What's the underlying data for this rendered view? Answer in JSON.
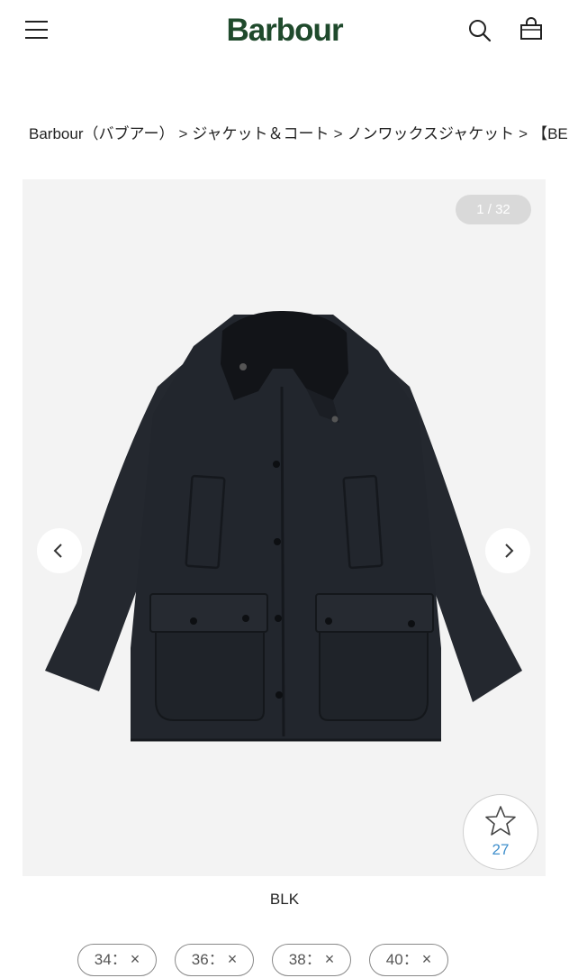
{
  "header": {
    "brand": "Barbour"
  },
  "breadcrumb": {
    "items": [
      "Barbour（バブアー）",
      "ジャケット＆コート",
      "ノンワックスジャケット",
      "【BEDALE"
    ],
    "separator": ">"
  },
  "gallery": {
    "counter": "1 / 32",
    "image": "black-jacket-product-photo"
  },
  "favorite": {
    "count": "27",
    "icon": "star-outline-icon"
  },
  "color_label": "BLK",
  "sizes": [
    {
      "size": "34：",
      "mark": "×"
    },
    {
      "size": "36：",
      "mark": "×"
    },
    {
      "size": "38：",
      "mark": "×"
    },
    {
      "size": "40：",
      "mark": "×"
    }
  ],
  "colors": {
    "brand": "#1f4a2c",
    "fav_count": "#3f8fcc",
    "jacket": "#22262d"
  }
}
